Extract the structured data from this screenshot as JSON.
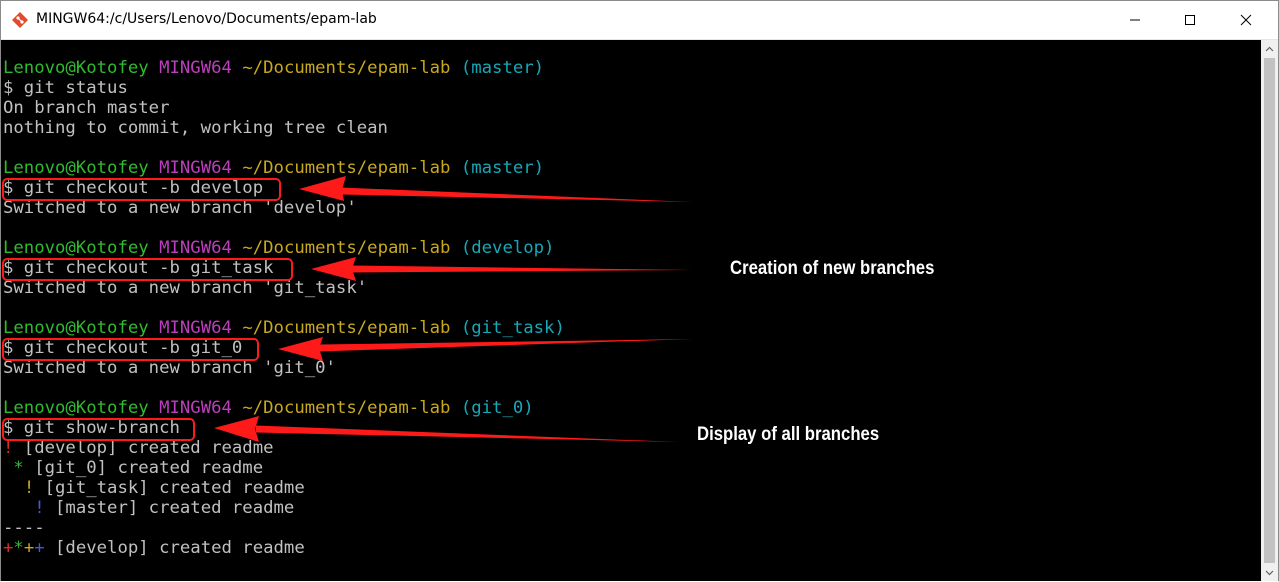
{
  "window": {
    "title": "MINGW64:/c/Users/Lenovo/Documents/epam-lab",
    "icon": "git-bash-icon",
    "controls": [
      "minimize-icon",
      "maximize-icon",
      "close-icon"
    ]
  },
  "prompts": [
    {
      "user": "Lenovo@Kotofey",
      "system": "MINGW64",
      "path": "~/Documents/epam-lab",
      "branch": "(master)"
    },
    {
      "user": "Lenovo@Kotofey",
      "system": "MINGW64",
      "path": "~/Documents/epam-lab",
      "branch": "(master)"
    },
    {
      "user": "Lenovo@Kotofey",
      "system": "MINGW64",
      "path": "~/Documents/epam-lab",
      "branch": "(develop)"
    },
    {
      "user": "Lenovo@Kotofey",
      "system": "MINGW64",
      "path": "~/Documents/epam-lab",
      "branch": "(git_task)"
    },
    {
      "user": "Lenovo@Kotofey",
      "system": "MINGW64",
      "path": "~/Documents/epam-lab",
      "branch": "(git_0)"
    }
  ],
  "commands": [
    "$ git status",
    "$ git checkout -b develop",
    "$ git checkout -b git_task",
    "$ git checkout -b git_0",
    "$ git show-branch"
  ],
  "outputs": {
    "status_1": "On branch master",
    "status_2": "nothing to commit, working tree clean",
    "switch_develop": "Switched to a new branch 'develop'",
    "switch_git_task": "Switched to a new branch 'git_task'",
    "switch_git_0": "Switched to a new branch 'git_0'",
    "show_branch": [
      {
        "marker": "!",
        "text": " [develop] created readme"
      },
      {
        "marker": "*",
        "text": " [git_0] created readme"
      },
      {
        "marker": "!",
        "text": " [git_task] created readme"
      },
      {
        "marker": "!",
        "text": " [master] created readme"
      }
    ],
    "separator": "----",
    "summary_markers": [
      "+",
      "*",
      "+",
      "+"
    ],
    "summary_text": " [develop] created readme"
  },
  "annotations": {
    "creation_label": "Creation of new branches",
    "display_label": "Display of all branches",
    "highlight_color": "#ff1a1a"
  },
  "colors": {
    "terminal_bg": "#000000",
    "text": "#c0c0c0",
    "user": "#2ebc2e",
    "system": "#bc3fbc",
    "path": "#c8a91c",
    "branch": "#16a8b8"
  }
}
